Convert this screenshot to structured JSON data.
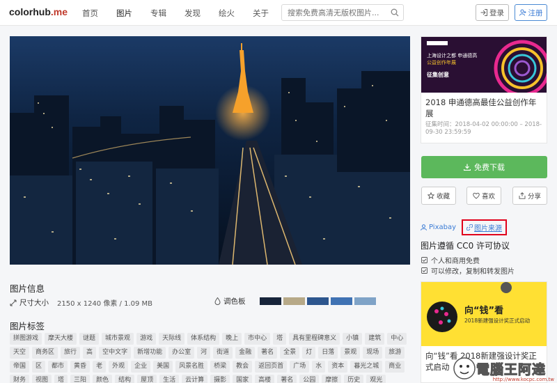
{
  "header": {
    "logo_main": "colorhub",
    "logo_dot": ".",
    "logo_suffix": "me",
    "nav": [
      "首页",
      "图片",
      "专辑",
      "发现",
      "绘火",
      "关于"
    ],
    "search_placeholder": "搜索免费高清无版权图片...",
    "login": "登录",
    "register": "注册"
  },
  "photo": {
    "icon": "tokyo-night-photo"
  },
  "info": {
    "title": "图片信息",
    "size_label": "尺寸大小",
    "size_value": "2150 x 1240 像素 / 1.09 MB",
    "palette_label": "调色板",
    "palette": [
      "#17243a",
      "#b7a988",
      "#2d568e",
      "#3f72b3",
      "#7fa3c7"
    ]
  },
  "tags_title": "图片标签",
  "tags": [
    "拼图游戏",
    "摩天大楼",
    "谜题",
    "城市景观",
    "游戏",
    "天际线",
    "体系结构",
    "晚上",
    "市中心",
    "塔",
    "具有里程碑意义",
    "小镇",
    "建筑",
    "中心",
    "天空",
    "商务区",
    "旅行",
    "高",
    "空中文字",
    "新增功能",
    "办公室",
    "河",
    "街道",
    "金融",
    "著名",
    "全景",
    "灯",
    "日落",
    "景观",
    "现场",
    "旅游",
    "帝国",
    "区",
    "都市",
    "黄昏",
    "老",
    "外观",
    "企业",
    "美国",
    "风景名胜",
    "桥梁",
    "教会",
    "返回页首",
    "广场",
    "水",
    "资本",
    "暮光之城",
    "商业",
    "财务",
    "视图",
    "塔",
    "三阳",
    "颜色",
    "结构",
    "屋顶",
    "生活",
    "云计算",
    "摄影",
    "国家",
    "高楼",
    "著名",
    "公园",
    "摩擦",
    "历史",
    "观光"
  ],
  "promo": {
    "title": "2018 申通德高最佳公益创作年展",
    "time": "征集时间：2018-04-02 00:00:00 – 2018-09-30 23:59:59",
    "img_line1": "上海设计之都 申通德高",
    "img_line2": "公益创作年展",
    "img_line3": "征集创意"
  },
  "download": "免费下载",
  "actions": {
    "collect": "收藏",
    "like": "喜欢",
    "share": "分享"
  },
  "source": {
    "author": "Pixabay",
    "link": "图片来源"
  },
  "license": {
    "title": "图片遵循 CC0 许可协议",
    "items": [
      "个人和商用免费",
      "可以修改，复制和转发图片"
    ]
  },
  "ad": {
    "title": "向“钱”看 2018新建强设计奖正式启动",
    "img_main": "向“钱”看",
    "img_sub": "2018新建强设计奖正式启动"
  },
  "watermark": {
    "text": "電腦王阿達",
    "url": "http://www.kocpc.com.tw"
  },
  "colors": {
    "accent_green": "#5cb85c",
    "link_blue": "#3a7bd5",
    "highlight_red": "#e0001b"
  }
}
